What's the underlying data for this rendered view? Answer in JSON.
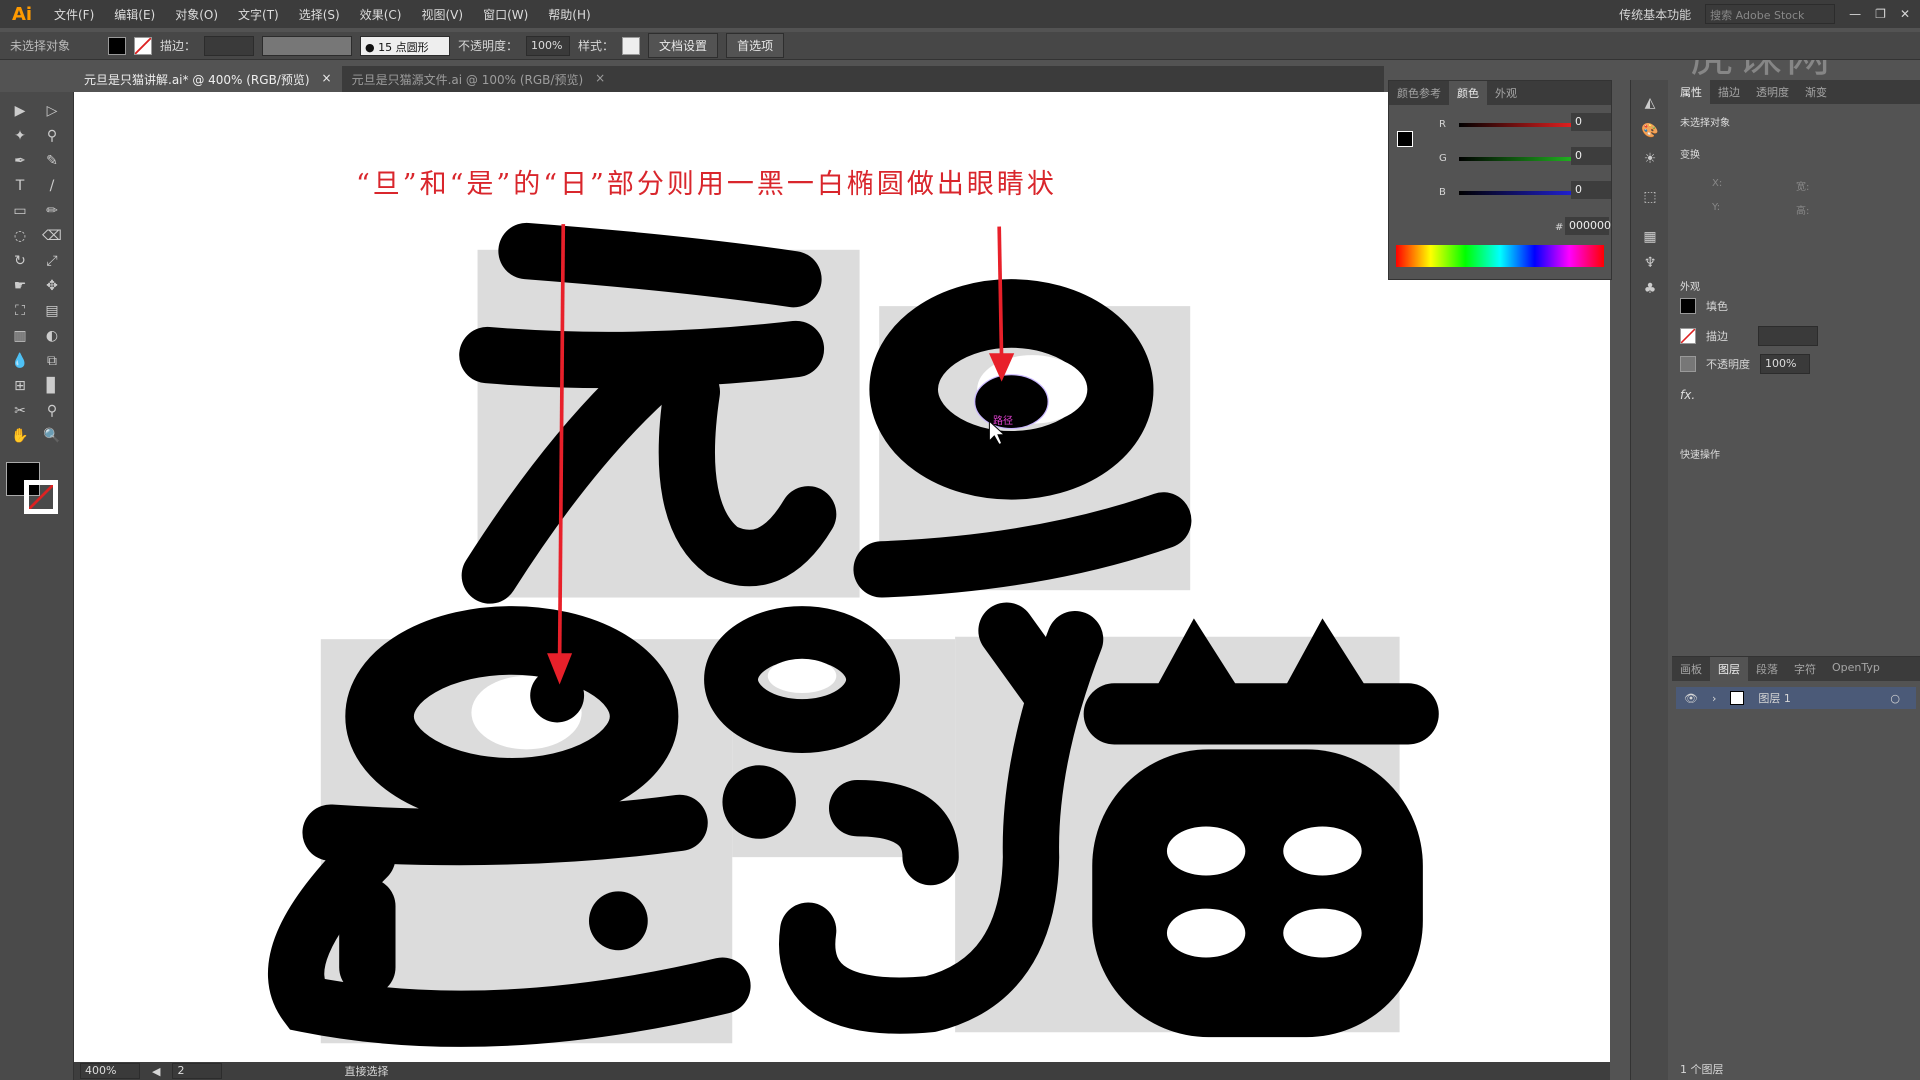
{
  "app": {
    "logo": "Ai",
    "menus": [
      "文件(F)",
      "编辑(E)",
      "对象(O)",
      "文字(T)",
      "选择(S)",
      "效果(C)",
      "视图(V)",
      "窗口(W)",
      "帮助(H)"
    ],
    "workspace": "传统基本功能",
    "search_placeholder": "搜索 Adobe Stock",
    "watermark": "虎课网"
  },
  "control": {
    "selection": "未选择对象",
    "stroke_label": "描边：",
    "brush": "15 点圆形",
    "opacity_label": "不透明度：",
    "opacity": "100%",
    "style_label": "样式：",
    "doc_setup": "文档设置",
    "prefs": "首选项"
  },
  "tabs": [
    {
      "label": "元旦是只猫讲解.ai* @ 400% (RGB/预览)",
      "active": true
    },
    {
      "label": "元旦是只猫源文件.ai @ 100% (RGB/预览)",
      "active": false
    }
  ],
  "artwork": {
    "caption": "“旦”和“是”的“日”部分则用一黑一白椭圆做出眼睛状",
    "path_label": "路径",
    "arrow_color": "#e8202a",
    "caption_color": "#d9262c"
  },
  "color_panel": {
    "tabs": [
      "颜色参考",
      "颜色",
      "外观"
    ],
    "active": 1,
    "r": "0",
    "g": "0",
    "b": "0",
    "hex": "000000",
    "r_label": "R",
    "g_label": "G",
    "b_label": "B",
    "hash": "#"
  },
  "properties": {
    "tabs": [
      "属性",
      "描边",
      "透明度",
      "渐变"
    ],
    "selection": "未选择对象",
    "transform": "变换",
    "x_label": "X:",
    "y_label": "Y:",
    "w_label": "宽:",
    "h_label": "高:",
    "appearance": "外观",
    "fill": "填色",
    "stroke": "描边",
    "opacity_label": "不透明度",
    "opacity": "100%",
    "fx": "fx.",
    "quick": "快速操作"
  },
  "layers": {
    "tabs": [
      "画板",
      "图层",
      "段落",
      "字符",
      "OpenTyp"
    ],
    "active": 1,
    "items": [
      "图层 1"
    ],
    "count": "1 个图层"
  },
  "status": {
    "zoom": "400%",
    "artboard": "2",
    "tool": "直接选择"
  }
}
